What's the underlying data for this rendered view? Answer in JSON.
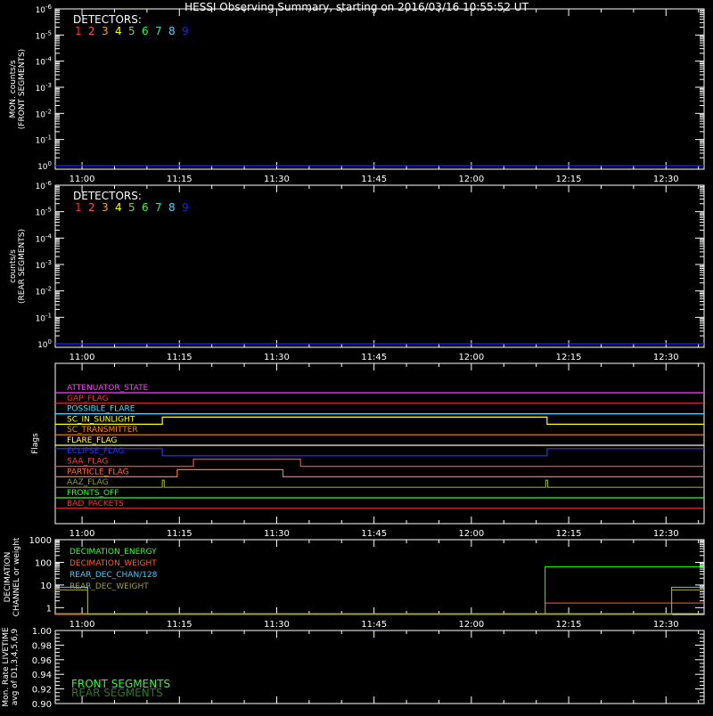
{
  "title": "HESSI Observing Summary, starting on 2016/03/16 10:55:52 UT",
  "time_axis": {
    "start_min": 0,
    "end_min": 100,
    "ticks": [
      {
        "min": 4.13,
        "label": "11:00"
      },
      {
        "min": 19.13,
        "label": "11:15"
      },
      {
        "min": 34.13,
        "label": "11:30"
      },
      {
        "min": 49.13,
        "label": "11:45"
      },
      {
        "min": 64.13,
        "label": "12:00"
      },
      {
        "min": 79.13,
        "label": "12:15"
      },
      {
        "min": 94.13,
        "label": "12:30"
      }
    ]
  },
  "colors": {
    "d1": "#ff3030",
    "d2": "#ff5050",
    "d3": "#ffa000",
    "d4": "#ffff00",
    "d5": "#a0c030",
    "d6": "#30ff30",
    "d7": "#30e0a0",
    "d8": "#60d0ff",
    "d9": "#2020ff"
  },
  "chart_data": [
    {
      "type": "line",
      "id": "front",
      "ylabel_lines": [
        "MON. counts/s",
        "(FRONT SEGMENTS)"
      ],
      "yscale": "log",
      "ylim_exp": [
        0,
        -6
      ],
      "ytick_exps": [
        0,
        -1,
        -2,
        -3,
        -4,
        -5,
        -6
      ],
      "legend_title": "DETECTORS:",
      "legend_entries": [
        "1",
        "2",
        "3",
        "4",
        "5",
        "6",
        "7",
        "8",
        "9"
      ],
      "series": [
        {
          "name": "9",
          "color": "#2020ff",
          "x": [
            0,
            100
          ],
          "y_exp": [
            0,
            0
          ]
        }
      ]
    },
    {
      "type": "line",
      "id": "rear",
      "ylabel_lines": [
        "counts/s",
        "(REAR SEGMENTS)"
      ],
      "yscale": "log",
      "ylim_exp": [
        0,
        -6
      ],
      "ytick_exps": [
        0,
        -1,
        -2,
        -3,
        -4,
        -5,
        -6
      ],
      "legend_title": "DETECTORS:",
      "legend_entries": [
        "1",
        "2",
        "3",
        "4",
        "5",
        "6",
        "7",
        "8",
        "9"
      ],
      "series": [
        {
          "name": "9",
          "color": "#2020ff",
          "x": [
            0,
            100
          ],
          "y_exp": [
            0,
            0
          ]
        }
      ]
    },
    {
      "type": "line",
      "id": "flags",
      "ylabel_lines": [
        "Flags"
      ],
      "flags": [
        {
          "name": "ATTENUATOR_STATE",
          "color": "#ff40ff",
          "base": 0,
          "segs": []
        },
        {
          "name": "GAP_FLAG",
          "color": "#ff3030",
          "base": 1,
          "segs": []
        },
        {
          "name": "POSSIBLE_FLARE",
          "color": "#40e0ff",
          "base": 2,
          "segs": []
        },
        {
          "name": "SC_IN_SUNLIGHT",
          "color": "#ffff00",
          "base": 3,
          "segs": [
            [
              16.5,
              75.8
            ]
          ]
        },
        {
          "name": "SC_TRANSMITTER",
          "color": "#ff8030",
          "base": 4,
          "segs": []
        },
        {
          "name": "FLARE_FLAG",
          "color": "#ffff60",
          "base": 5,
          "segs": []
        },
        {
          "name": "ECLIPSE_FLAG",
          "color": "#3030ff",
          "base": 6,
          "segs": [
            [
              0,
              16.5
            ],
            [
              75.8,
              100
            ]
          ]
        },
        {
          "name": "SAA_FLAG",
          "color": "#ff4040",
          "base": 7,
          "segs": [
            [
              21.3,
              37.8
            ]
          ]
        },
        {
          "name": "PARTICLE_FLAG",
          "color": "#ff7040",
          "base": 8,
          "segs": [
            [
              18.8,
              35.1
            ]
          ]
        },
        {
          "name": "AAZ_FLAG",
          "color": "#90a030",
          "base": 9,
          "segs": [
            [
              16.5,
              16.8
            ],
            [
              75.6,
              75.9
            ]
          ]
        },
        {
          "name": "FRONTS_OFF",
          "color": "#30ff30",
          "base": 10,
          "segs": []
        },
        {
          "name": "BAD_PACKETS",
          "color": "#ff3030",
          "base": 11,
          "segs": []
        }
      ]
    },
    {
      "type": "line",
      "id": "decimation",
      "ylabel_lines": [
        "DECIMATION",
        "CHANNEL or weight"
      ],
      "yscale": "log",
      "ylim": [
        0.5,
        1000
      ],
      "yticks": [
        {
          "v": 1,
          "label": "1"
        },
        {
          "v": 10,
          "label": "10"
        },
        {
          "v": 100,
          "label": "100"
        },
        {
          "v": 1000,
          "label": "1000"
        }
      ],
      "legend": [
        {
          "name": "DECIMATION_ENERGY",
          "color": "#30ff30"
        },
        {
          "name": "DECIMATION_WEIGHT",
          "color": "#ff6030"
        },
        {
          "name": "REAR_DEC_CHAN/128",
          "color": "#40d0ff"
        },
        {
          "name": "REAR_DEC_WEIGHT",
          "color": "#a0a040"
        }
      ],
      "series": [
        {
          "name": "DECIMATION_ENERGY",
          "color": "#30ff30",
          "steps": [
            [
              0,
              0.5
            ],
            [
              75.5,
              64
            ],
            [
              100,
              64
            ]
          ]
        },
        {
          "name": "DECIMATION_WEIGHT",
          "color": "#ff6030",
          "steps": [
            [
              0,
              0.5
            ],
            [
              75.5,
              1.6
            ],
            [
              95,
              1.6
            ],
            [
              100,
              1.6
            ]
          ]
        },
        {
          "name": "REAR_DEC_CHAN/128",
          "color": "#40d0ff",
          "steps": [
            [
              0,
              8
            ],
            [
              5,
              0.5
            ],
            [
              95,
              8
            ],
            [
              100,
              8
            ]
          ]
        },
        {
          "name": "REAR_DEC_WEIGHT",
          "color": "#a0a040",
          "steps": [
            [
              0,
              6
            ],
            [
              5,
              0.5
            ],
            [
              95,
              6
            ],
            [
              100,
              6
            ]
          ]
        }
      ]
    },
    {
      "type": "line",
      "id": "livetime",
      "ylabel_lines": [
        "Mon. Rate LIVETIME",
        "avg of D1,3,4,5,6,9"
      ],
      "ylim": [
        0.9,
        1.0
      ],
      "yticks": [
        {
          "v": 0.9,
          "label": "0.90"
        },
        {
          "v": 0.92,
          "label": "0.92"
        },
        {
          "v": 0.94,
          "label": "0.94"
        },
        {
          "v": 0.96,
          "label": "0.96"
        },
        {
          "v": 0.98,
          "label": "0.98"
        },
        {
          "v": 1.0,
          "label": "1.00"
        }
      ],
      "legend": [
        {
          "name": "FRONT SEGMENTS",
          "color": "#30ff30"
        },
        {
          "name": "REAR SEGMENTS",
          "color": "#208020"
        }
      ],
      "series": []
    }
  ]
}
